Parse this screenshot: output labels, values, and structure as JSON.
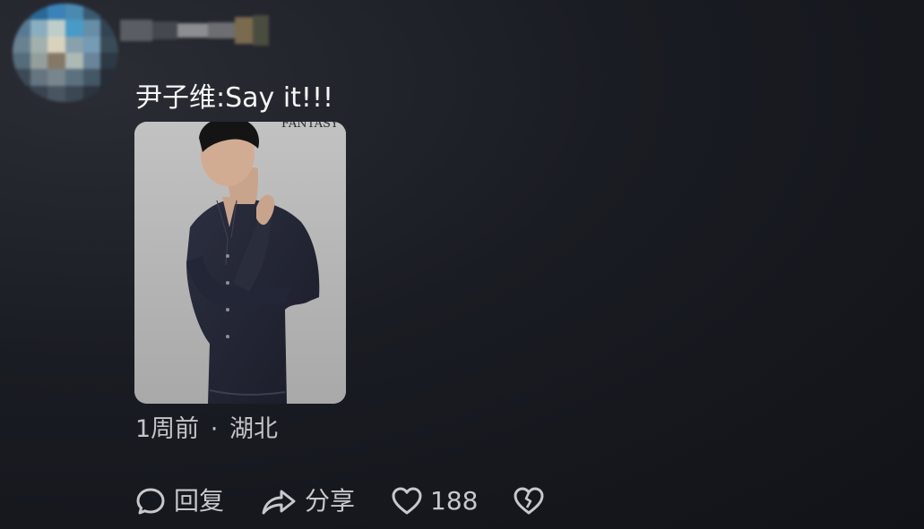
{
  "comment": {
    "text": "尹子维:Say it!!!",
    "image_caption_fragment": "FANTASY",
    "time": "1周前",
    "separator": "·",
    "location": "湖北"
  },
  "actions": {
    "reply_label": "回复",
    "share_label": "分享",
    "like_count": "188"
  },
  "icons": {
    "reply": "speech-bubble-icon",
    "share": "share-arrow-icon",
    "like": "heart-icon",
    "dislike": "broken-heart-icon"
  },
  "colors": {
    "background": "#16181e",
    "text_primary": "#f5f5f5",
    "text_secondary": "#c4c4c8"
  }
}
